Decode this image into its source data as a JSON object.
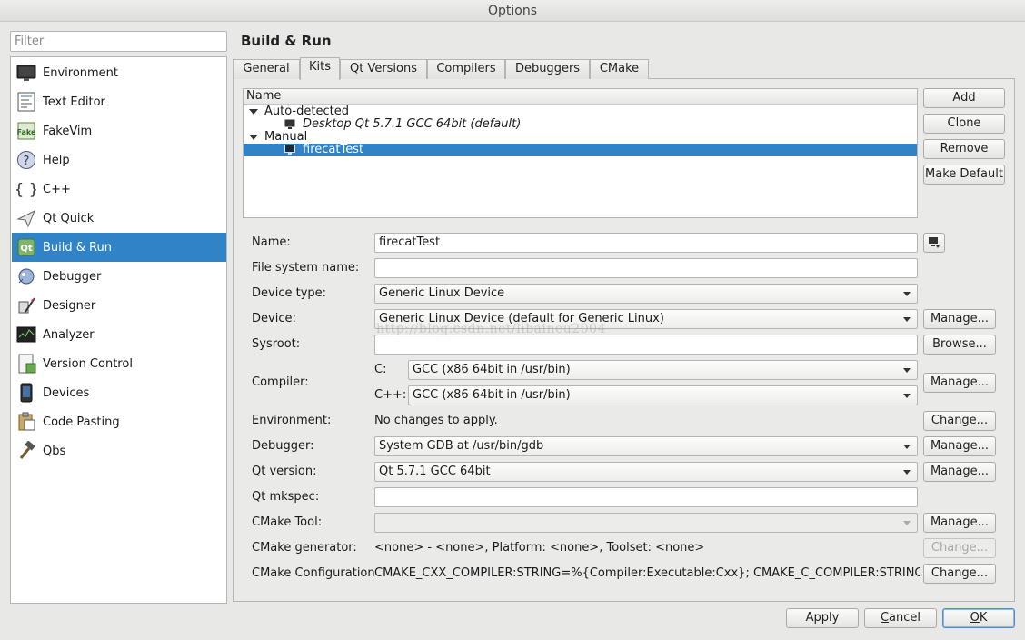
{
  "window": {
    "title": "Options"
  },
  "filter": {
    "placeholder": "Filter",
    "value": ""
  },
  "sidebar": {
    "items": [
      {
        "label": "Environment",
        "icon": "monitor-icon"
      },
      {
        "label": "Text Editor",
        "icon": "text-editor-icon"
      },
      {
        "label": "FakeVim",
        "icon": "fakevim-icon"
      },
      {
        "label": "Help",
        "icon": "help-icon"
      },
      {
        "label": "C++",
        "icon": "cpp-braces-icon"
      },
      {
        "label": "Qt Quick",
        "icon": "qt-quick-icon"
      },
      {
        "label": "Build & Run",
        "icon": "build-run-icon",
        "selected": true
      },
      {
        "label": "Debugger",
        "icon": "debugger-icon"
      },
      {
        "label": "Designer",
        "icon": "designer-icon"
      },
      {
        "label": "Analyzer",
        "icon": "analyzer-icon"
      },
      {
        "label": "Version Control",
        "icon": "version-control-icon"
      },
      {
        "label": "Devices",
        "icon": "devices-icon"
      },
      {
        "label": "Code Pasting",
        "icon": "code-pasting-icon"
      },
      {
        "label": "Qbs",
        "icon": "qbs-hammer-icon"
      }
    ]
  },
  "page": {
    "title": "Build & Run",
    "tabs": [
      "General",
      "Kits",
      "Qt Versions",
      "Compilers",
      "Debuggers",
      "CMake"
    ],
    "active_tab": "Kits"
  },
  "kits_tree": {
    "header": "Name",
    "groups": [
      {
        "label": "Auto-detected",
        "kits": [
          {
            "label": "Desktop Qt 5.7.1 GCC 64bit (default)",
            "italic": true
          }
        ]
      },
      {
        "label": "Manual",
        "kits": [
          {
            "label": "firecatTest",
            "selected": true
          }
        ]
      }
    ]
  },
  "kit_buttons": {
    "add": "Add",
    "clone": "Clone",
    "remove": "Remove",
    "make_default": "Make Default"
  },
  "form": {
    "name": {
      "label": "Name:",
      "value": "firecatTest"
    },
    "file_system_name": {
      "label": "File system name:",
      "value": ""
    },
    "device_type": {
      "label": "Device type:",
      "value": "Generic Linux Device"
    },
    "device": {
      "label": "Device:",
      "value": "Generic Linux Device (default for Generic Linux)",
      "button": "Manage..."
    },
    "sysroot": {
      "label": "Sysroot:",
      "value": "",
      "button": "Browse..."
    },
    "compiler": {
      "label": "Compiler:",
      "c_label": "C:",
      "c_value": "GCC (x86 64bit in /usr/bin)",
      "cpp_label": "C++:",
      "cpp_value": "GCC (x86 64bit in /usr/bin)",
      "button": "Manage..."
    },
    "environment": {
      "label": "Environment:",
      "value": "No changes to apply.",
      "button": "Change..."
    },
    "debugger": {
      "label": "Debugger:",
      "value": "System GDB at /usr/bin/gdb",
      "button": "Manage..."
    },
    "qt_version": {
      "label": "Qt version:",
      "value": "Qt 5.7.1 GCC 64bit",
      "button": "Manage..."
    },
    "qt_mkspec": {
      "label": "Qt mkspec:",
      "value": ""
    },
    "cmake_tool": {
      "label": "CMake Tool:",
      "value": "",
      "button": "Manage..."
    },
    "cmake_generator": {
      "label": "CMake generator:",
      "value": "<none> - <none>, Platform: <none>, Toolset: <none>",
      "button": "Change..."
    },
    "cmake_configuration": {
      "label": "CMake Configuration",
      "value": "CMAKE_CXX_COMPILER:STRING=%{Compiler:Executable:Cxx}; CMAKE_C_COMPILER:STRING=%{C...",
      "button": "Change..."
    }
  },
  "watermark": "http://blog.csdn.net/libaineu2004",
  "dialog_buttons": {
    "apply": "Apply",
    "cancel_pre": "",
    "cancel_u": "C",
    "cancel_post": "ancel",
    "ok_u": "O",
    "ok_post": "K"
  },
  "colors": {
    "selection": "#2f83c6",
    "background": "#e8e8e7"
  }
}
